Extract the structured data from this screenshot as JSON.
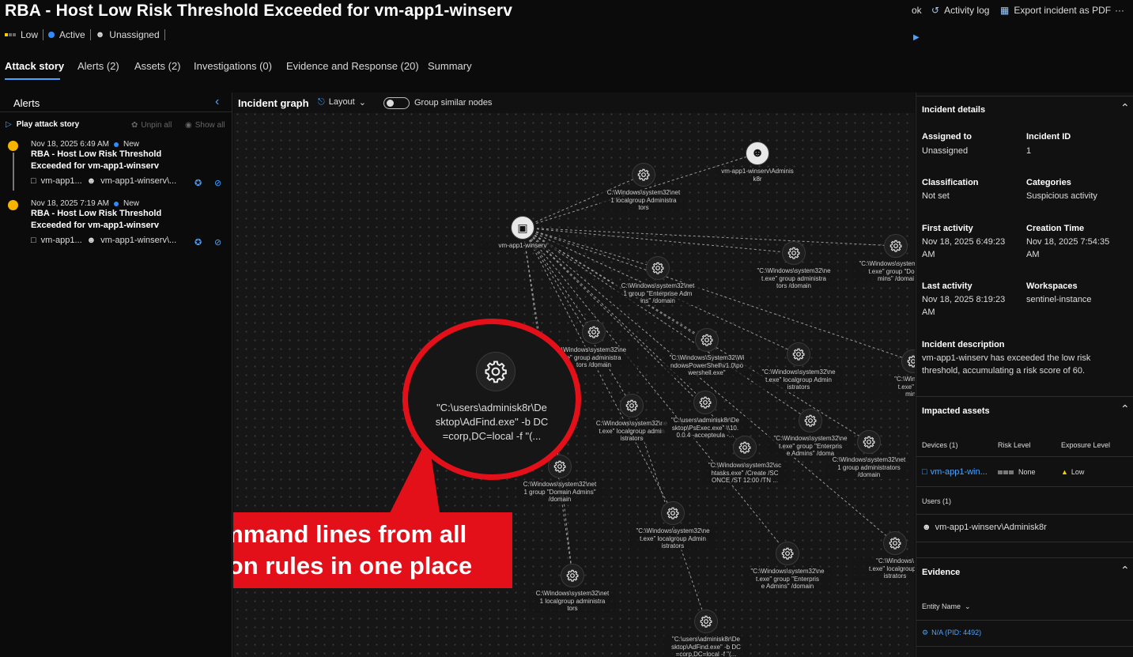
{
  "incident": {
    "title": "RBA - Host Low Risk Threshold Exceeded for vm-app1-winserv",
    "severity": "Low",
    "status": "Active",
    "assigned": "Unassigned"
  },
  "top_actions": {
    "partial": "ok",
    "activity_log": "Activity log",
    "export": "Export incident as PDF",
    "more": "···"
  },
  "tabs": [
    {
      "label": "Attack story"
    },
    {
      "label": "Alerts (2)"
    },
    {
      "label": "Assets (2)"
    },
    {
      "label": "Investigations (0)"
    },
    {
      "label": "Evidence and Response (20)"
    },
    {
      "label": "Summary"
    }
  ],
  "alerts_pane": {
    "title": "Alerts",
    "play": "Play attack story",
    "unpin": "Unpin all",
    "show": "Show all",
    "items": [
      {
        "date": "Nov 18, 2025 6:49 AM",
        "status": "New",
        "title1": "RBA - Host Low Risk Threshold",
        "title2": "Exceeded for vm-app1-winserv",
        "device": "vm-app1...",
        "user": "vm-app1-winserv\\..."
      },
      {
        "date": "Nov 18, 2025 7:19 AM",
        "status": "New",
        "title1": "RBA - Host Low Risk Threshold",
        "title2": "Exceeded for vm-app1-winserv",
        "device": "vm-app1...",
        "user": "vm-app1-winserv\\..."
      }
    ]
  },
  "graph": {
    "title": "Incident graph",
    "layout": "Layout",
    "group": "Group similar nodes",
    "host_label": "vm-app1-winserv",
    "user_label": [
      "vm-app1-winserv\\Adminis",
      "k8r"
    ],
    "nodes": [
      {
        "l": [
          "C:\\Windows\\system32\\net",
          "1 localgroup Administra",
          "tors"
        ]
      },
      {
        "l": [
          "\"C:\\Windows\\system32\\ne",
          "t.exe\" group administra",
          "tors /domain"
        ]
      },
      {
        "l": [
          "\"C:\\Windows\\system32\\ne",
          "t.exe\" group \"Doma",
          "mins\" /domai"
        ]
      },
      {
        "l": [
          "C:\\Windows\\system32\\net",
          "1 group \"Enterprise Adm",
          "ins\" /domain"
        ]
      },
      {
        "l": [
          "\\Windows\\system32\\ne",
          "e\" group administra",
          "tors /domain"
        ]
      },
      {
        "l": [
          "\"C:\\Windows\\System32\\Wi",
          "ndowsPowerShell\\v1.0\\po",
          "wershell.exe\""
        ]
      },
      {
        "l": [
          "\"C:\\Windows\\system32\\ne",
          "t.exe\" localgroup Admin",
          "istrators"
        ]
      },
      {
        "l": [
          "\"C:\\Windows\\",
          "t.exe\" grou",
          "mins\""
        ]
      },
      {
        "l": [
          "C:\\Windows\\system32\\ne",
          "t.exe\" localgroup admin",
          "istrators"
        ]
      },
      {
        "l": [
          "\"C:\\users\\adminisk8r\\De",
          "sktop\\PsExec.exe\" \\\\10.",
          "0.0.4 -accepteula -..."
        ]
      },
      {
        "l": [
          "\"C:\\Windows\\system32\\ne",
          "t.exe\" group \"Enterpris",
          "e Admins\" /doma"
        ]
      },
      {
        "l": [
          "C:\\Windows\\system32\\net",
          "1 group administrators",
          "/domain"
        ]
      },
      {
        "l": [
          "\"C:\\Windows\\system32\\sc",
          "htasks.exe\" /Create /SC",
          "ONCE /ST 12:00 /TN ..."
        ]
      },
      {
        "l": [
          "C:\\Windows\\system32\\net",
          "1 group \"Domain Admins\"",
          "/domain"
        ]
      },
      {
        "l": [
          "\"C:\\Windows\\system32\\ne",
          "t.exe\" localgroup Admin",
          "istrators"
        ]
      },
      {
        "l": [
          "\"C:\\Windows\\system32\\ne",
          "t.exe\" group \"Enterpris",
          "e Admins\" /domain"
        ]
      },
      {
        "l": [
          "\"C:\\Windows\\",
          "t.exe\" localgroup a",
          "istrators"
        ]
      },
      {
        "l": [
          "C:\\Windows\\system32\\net",
          "1 localgroup administra",
          "tors"
        ]
      },
      {
        "l": [
          "\"C:\\users\\adminisk8r\\De",
          "sktop\\AdFind.exe\" -b DC",
          "=corp,DC=local -f \"(..."
        ]
      }
    ],
    "zoom_label": [
      "\"C:\\users\\adminisk8r\\De",
      "sktop\\AdFind.exe\" -b DC",
      "=corp,DC=local -f \"(..."
    ],
    "callout": [
      "All command lines from all",
      "detection rules in one place"
    ]
  },
  "details": {
    "title": "Incident details",
    "assigned_h": "Assigned to",
    "assigned_v": "Unassigned",
    "id_h": "Incident ID",
    "id_v": "1",
    "class_h": "Classification",
    "class_v": "Not set",
    "cat_h": "Categories",
    "cat_v": "Suspicious activity",
    "first_h": "First activity",
    "first_v1": "Nov 18, 2025 6:49:23",
    "first_v2": "AM",
    "create_h": "Creation Time",
    "create_v1": "Nov 18, 2025 7:54:35",
    "create_v2": "AM",
    "last_h": "Last activity",
    "last_v1": "Nov 18, 2025 8:19:23",
    "last_v2": "AM",
    "ws_h": "Workspaces",
    "ws_v": "sentinel-instance",
    "desc_h": "Incident description",
    "desc_v1": "vm-app1-winserv has exceeded the low risk",
    "desc_v2": "threshold, accumulating a risk score of 60."
  },
  "assets": {
    "title": "Impacted assets",
    "devices_h": "Devices (1)",
    "risk_h": "Risk Level",
    "exposure_h": "Exposure Level",
    "device": "vm-app1-win...",
    "risk": "None",
    "exposure": "Low",
    "users_h": "Users (1)",
    "user": "vm-app1-winserv\\Adminisk8r"
  },
  "evidence": {
    "title": "Evidence",
    "entity_h": "Entity Name",
    "first": "N/A (PID: 4492)"
  }
}
